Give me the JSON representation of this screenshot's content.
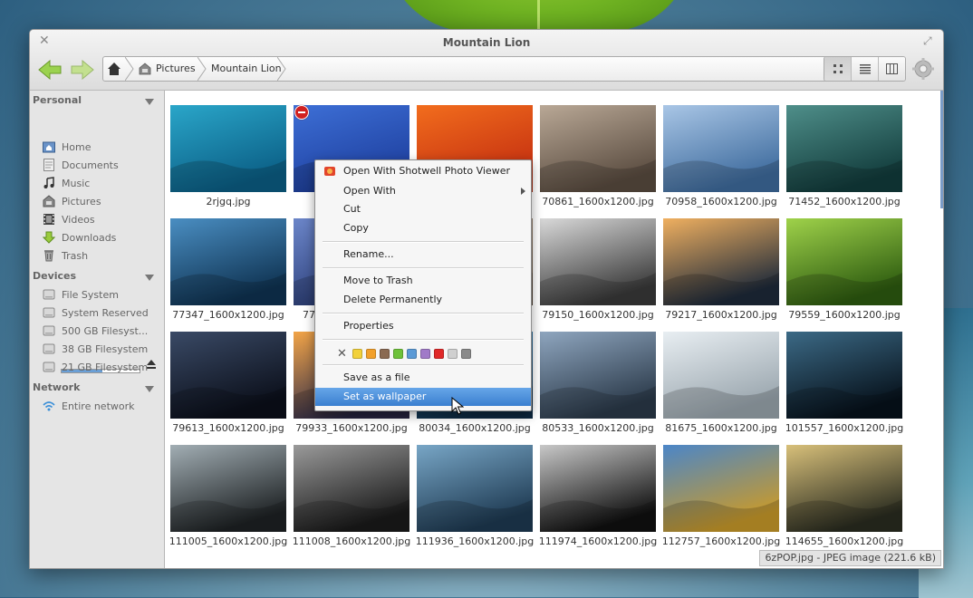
{
  "window": {
    "title": "Mountain Lion"
  },
  "breadcrumb": {
    "items": [
      "Pictures",
      "Mountain Lion"
    ]
  },
  "sidebar": {
    "sections": [
      {
        "header": "Personal",
        "items": [
          "Home",
          "Documents",
          "Music",
          "Pictures",
          "Videos",
          "Downloads",
          "Trash"
        ]
      },
      {
        "header": "Devices",
        "items": [
          "File System",
          "System Reserved",
          "500 GB Filesyst...",
          "38 GB Filesystem",
          "21 GB Filesystem"
        ]
      },
      {
        "header": "Network",
        "items": [
          "Entire network"
        ]
      }
    ],
    "drive_usage_500gb": 0.52
  },
  "files": [
    {
      "name": "2rjgq.jpg",
      "c1": "#2aa6c9",
      "c2": "#0b5f86"
    },
    {
      "name": "",
      "c1": "#3d6fd6",
      "c2": "#1e3f9e"
    },
    {
      "name": "",
      "c1": "#f26d1d",
      "c2": "#c42f10"
    },
    {
      "name": "70861_1600x1200.jpg",
      "c1": "#b9a896",
      "c2": "#5a4c40"
    },
    {
      "name": "70958_1600x1200.jpg",
      "c1": "#a9c6e6",
      "c2": "#3f6c9e"
    },
    {
      "name": "71452_1600x1200.jpg",
      "c1": "#4f8f8a",
      "c2": "#123c3c"
    },
    {
      "name": "77347_1600x1200.jpg",
      "c1": "#4a8ec2",
      "c2": "#0f3352"
    },
    {
      "name": "77",
      "c1": "#6b85c8",
      "c2": "#2c3f7a"
    },
    {
      "name": "",
      "c1": "#b6a08a",
      "c2": "#5a4a3a"
    },
    {
      "name": "79150_1600x1200.jpg",
      "c1": "#d9d9d9",
      "c2": "#3a3a3a"
    },
    {
      "name": "79217_1600x1200.jpg",
      "c1": "#f0b060",
      "c2": "#1e2a3a"
    },
    {
      "name": "79559_1600x1200.jpg",
      "c1": "#9fd24a",
      "c2": "#2e5c10"
    },
    {
      "name": "79613_1600x1200.jpg",
      "c1": "#3a4a66",
      "c2": "#0b0f1a"
    },
    {
      "name": "79933_1600x1200.jpg",
      "c1": "#f2a447",
      "c2": "#2c2a4a"
    },
    {
      "name": "80034_1600x1200.jpg",
      "c1": "#3a8cc2",
      "c2": "#10304c"
    },
    {
      "name": "80533_1600x1200.jpg",
      "c1": "#8fa6bf",
      "c2": "#2b3a4a"
    },
    {
      "name": "81675_1600x1200.jpg",
      "c1": "#e8eef2",
      "c2": "#9aa6ae"
    },
    {
      "name": "101557_1600x1200.jpg",
      "c1": "#3c6a86",
      "c2": "#07121c"
    },
    {
      "name": "111005_1600x1200.jpg",
      "c1": "#a2aeb4",
      "c2": "#1e2224"
    },
    {
      "name": "111008_1600x1200.jpg",
      "c1": "#9a9a9a",
      "c2": "#1a1a1a"
    },
    {
      "name": "111936_1600x1200.jpg",
      "c1": "#78a6c6",
      "c2": "#1e3a52"
    },
    {
      "name": "111974_1600x1200.jpg",
      "c1": "#c8c8c8",
      "c2": "#101010"
    },
    {
      "name": "112757_1600x1200.jpg",
      "c1": "#4b86c8",
      "c2": "#c99a2a"
    },
    {
      "name": "114655_1600x1200.jpg",
      "c1": "#d8c07a",
      "c2": "#2a2c20"
    }
  ],
  "context_menu": {
    "items": [
      {
        "label": "Open With Shotwell Photo Viewer",
        "icon": "shotwell-icon"
      },
      {
        "label": "Open With",
        "submenu": true
      },
      {
        "label": "Cut"
      },
      {
        "label": "Copy"
      },
      {
        "label": "Rename..."
      },
      {
        "label": "Move to Trash"
      },
      {
        "label": "Delete Permanently"
      },
      {
        "label": "Properties"
      },
      {
        "label": "Save as a file"
      },
      {
        "label": "Set as wallpaper",
        "highlighted": true
      }
    ],
    "tag_colors": [
      "#f2d13a",
      "#f2a02a",
      "#8a6a52",
      "#6ec23a",
      "#5b9ad6",
      "#a07ac8",
      "#e02828",
      "#cfcfcf",
      "#8a8a8a"
    ]
  },
  "status": {
    "text": "6zPOP.jpg - JPEG image (221.6 kB)"
  },
  "colors": {
    "selection": "#3b7fd0",
    "nav_arrow": "#8bc34a"
  }
}
